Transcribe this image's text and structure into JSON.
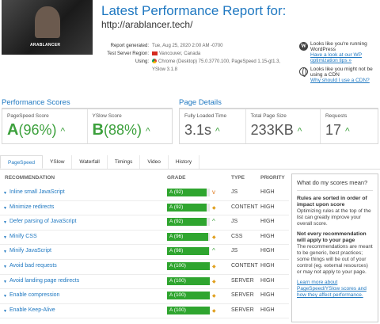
{
  "header": {
    "title": "Latest Performance Report for:",
    "url": "http://arablancer.tech/",
    "thumbnail_text": "ARABLANCER"
  },
  "meta": {
    "report_generated_label": "Report generated:",
    "report_generated_value": "Tue, Aug 25, 2020 2:00 AM -0700",
    "test_server_label": "Test Server Region:",
    "test_server_value": "Vancouver, Canada",
    "using_label": "Using:",
    "using_value_line1": "Chrome (Desktop) 75.0.3770.100, PageSpeed 1.15-gt1.3,",
    "using_value_line2": "YSlow 3.1.8"
  },
  "notes": {
    "wp_text": "Looks like you're running WordPress",
    "wp_link": "Have a look at our WP optimization tips »",
    "cdn_text": "Looks like you might not be using a CDN",
    "cdn_link": "Why should I use a CDN?"
  },
  "performance_scores": {
    "title": "Performance Scores",
    "pagespeed_label": "PageSpeed Score",
    "pagespeed_grade": "A",
    "pagespeed_value": "(96%)",
    "yslow_label": "YSlow Score",
    "yslow_grade": "B",
    "yslow_value": "(88%)"
  },
  "page_details": {
    "title": "Page Details",
    "load_label": "Fully Loaded Time",
    "load_value": "3.1s",
    "size_label": "Total Page Size",
    "size_value": "233KB",
    "requests_label": "Requests",
    "requests_value": "17"
  },
  "tabs": [
    "PageSpeed",
    "YSlow",
    "Waterfall",
    "Timings",
    "Video",
    "History"
  ],
  "table": {
    "col_recommendation": "RECOMMENDATION",
    "col_grade": "GRADE",
    "col_type": "TYPE",
    "col_priority": "PRIORITY"
  },
  "recommendations": [
    {
      "name": "Inline small JavaScript",
      "grade": "A (92)",
      "score": 92,
      "trend": "down",
      "type": "JS",
      "priority": "HIGH"
    },
    {
      "name": "Minimize redirects",
      "grade": "A (92)",
      "score": 92,
      "trend": "flat",
      "type": "CONTENT",
      "priority": "HIGH"
    },
    {
      "name": "Defer parsing of JavaScript",
      "grade": "A (92)",
      "score": 92,
      "trend": "up",
      "type": "JS",
      "priority": "HIGH"
    },
    {
      "name": "Minify CSS",
      "grade": "A (96)",
      "score": 96,
      "trend": "flat",
      "type": "CSS",
      "priority": "HIGH"
    },
    {
      "name": "Minify JavaScript",
      "grade": "A (98)",
      "score": 98,
      "trend": "up",
      "type": "JS",
      "priority": "HIGH"
    },
    {
      "name": "Avoid bad requests",
      "grade": "A (100)",
      "score": 100,
      "trend": "flat",
      "type": "CONTENT",
      "priority": "HIGH"
    },
    {
      "name": "Avoid landing page redirects",
      "grade": "A (100)",
      "score": 100,
      "trend": "flat",
      "type": "SERVER",
      "priority": "HIGH"
    },
    {
      "name": "Enable compression",
      "grade": "A (100)",
      "score": 100,
      "trend": "flat",
      "type": "SERVER",
      "priority": "HIGH"
    },
    {
      "name": "Enable Keep-Alive",
      "grade": "A (100)",
      "score": 100,
      "trend": "flat",
      "type": "SERVER",
      "priority": "HIGH"
    }
  ],
  "help": {
    "title": "What do my scores mean?",
    "bold1": "Rules are sorted in order of impact upon score",
    "text1": "Optimizing rules at the top of the list can greatly improve your overall score.",
    "bold2": "Not every recommendation will apply to your page",
    "text2": "The recommendations are meant to be generic, best practices; some things will be out of your control (eg. external resources) or may not apply to your page.",
    "link": "Learn more about PageSpeed/YSlow scores and how they affect performance."
  },
  "colors": {
    "accent": "#1f78c1",
    "grade_green": "#2fa52f"
  }
}
